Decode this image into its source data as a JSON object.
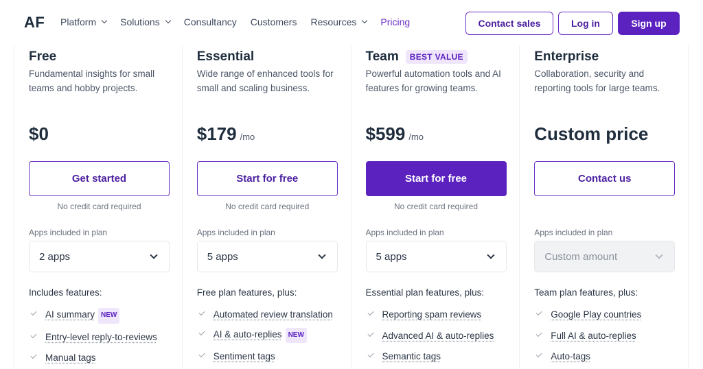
{
  "nav": {
    "logo": "AF",
    "items": [
      {
        "label": "Platform",
        "dropdown": true
      },
      {
        "label": "Solutions",
        "dropdown": true
      },
      {
        "label": "Consultancy",
        "dropdown": false
      },
      {
        "label": "Customers",
        "dropdown": false
      },
      {
        "label": "Resources",
        "dropdown": true
      },
      {
        "label": "Pricing",
        "dropdown": false,
        "active": true
      }
    ],
    "contact_sales": "Contact sales",
    "login": "Log in",
    "signup": "Sign up"
  },
  "plans": [
    {
      "name": "Free",
      "badge": "",
      "description": "Fundamental insights for small teams and hobby projects.",
      "price": "$0",
      "period": "",
      "cta": "Get started",
      "cta_style": "outline",
      "note": "No credit card required",
      "apps_label": "Apps included in plan",
      "apps_value": "2 apps",
      "features_heading": "Includes features:",
      "features": [
        {
          "label": "AI summary",
          "badge": "NEW"
        },
        {
          "label": "Entry-level reply-to-reviews",
          "badge": ""
        },
        {
          "label": "Manual tags",
          "badge": ""
        }
      ]
    },
    {
      "name": "Essential",
      "badge": "",
      "description": "Wide range of enhanced tools for small and scaling business.",
      "price": "$179",
      "period": "/mo",
      "cta": "Start for free",
      "cta_style": "outline",
      "note": "No credit card required",
      "apps_label": "Apps included in plan",
      "apps_value": "5 apps",
      "features_heading": "Free plan features, plus:",
      "features": [
        {
          "label": "Automated review translation",
          "badge": ""
        },
        {
          "label": "AI & auto-replies",
          "badge": "NEW"
        },
        {
          "label": "Sentiment tags",
          "badge": ""
        }
      ]
    },
    {
      "name": "Team",
      "badge": "BEST VALUE",
      "description": "Powerful automation tools and AI features for growing teams.",
      "price": "$599",
      "period": "/mo",
      "cta": "Start for free",
      "cta_style": "solid",
      "note": "No credit card required",
      "apps_label": "Apps included in plan",
      "apps_value": "5 apps",
      "features_heading": "Essential plan features, plus:",
      "features": [
        {
          "label": "Reporting spam reviews",
          "badge": ""
        },
        {
          "label": "Advanced AI & auto-replies",
          "badge": ""
        },
        {
          "label": "Semantic tags",
          "badge": ""
        }
      ]
    },
    {
      "name": "Enterprise",
      "badge": "",
      "description": "Collaboration, security and reporting tools for large teams.",
      "price": "Custom price",
      "period": "",
      "cta": "Contact us",
      "cta_style": "outline",
      "note": "",
      "apps_label": "Apps included in plan",
      "apps_value": "Custom amount",
      "apps_disabled": true,
      "features_heading": "Team plan features, plus:",
      "features": [
        {
          "label": "Google Play countries",
          "badge": ""
        },
        {
          "label": "Full AI & auto-replies",
          "badge": ""
        },
        {
          "label": "Auto-tags",
          "badge": ""
        }
      ]
    }
  ],
  "colors": {
    "accent": "#5b22c0",
    "text": "#1f2d3d",
    "badge_bg": "#efe6fb"
  }
}
